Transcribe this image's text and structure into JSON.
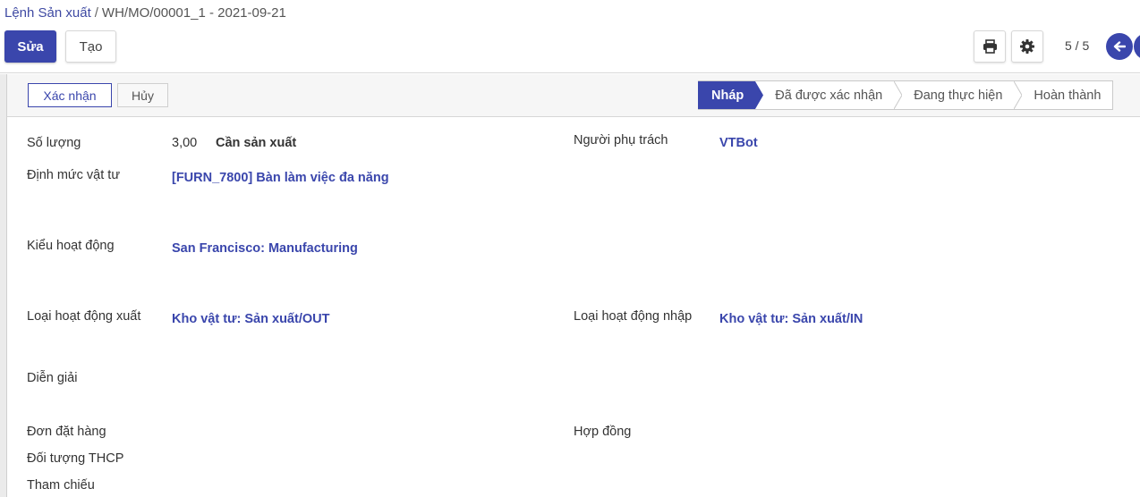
{
  "breadcrumb": {
    "parent": "Lệnh Sản xuất",
    "separator": "/",
    "current": "WH/MO/00001_1 - 2021-09-21"
  },
  "toolbar": {
    "edit_label": "Sửa",
    "create_label": "Tạo",
    "print_icon": "printer-icon",
    "settings_icon": "gear-icon"
  },
  "pager": {
    "value": "5 / 5",
    "prev_icon": "arrow-left-icon",
    "next_icon": "arrow-right-icon"
  },
  "statusbar": {
    "confirm_label": "Xác nhận",
    "cancel_label": "Hủy",
    "stages": [
      {
        "label": "Nháp",
        "active": true
      },
      {
        "label": "Đã được xác nhận",
        "active": false
      },
      {
        "label": "Đang thực hiện",
        "active": false
      },
      {
        "label": "Hoàn thành",
        "active": false
      }
    ]
  },
  "form": {
    "quantity": {
      "label": "Số lượng",
      "value": "3,00",
      "unit": "Cần sản xuất"
    },
    "responsible": {
      "label": "Người phụ trách",
      "value": "VTBot"
    },
    "bom": {
      "label": "Định mức vật tư",
      "value": "[FURN_7800] Bàn làm việc đa năng"
    },
    "operation_type": {
      "label": "Kiểu hoạt động",
      "value": "San Francisco: Manufacturing"
    },
    "out_operation": {
      "label": "Loại hoạt động xuất",
      "value": "Kho vật tư: Sản xuất/OUT"
    },
    "in_operation": {
      "label": "Loại hoạt động nhập",
      "value": "Kho vật tư: Sản xuất/IN"
    },
    "description": {
      "label": "Diễn giải"
    },
    "sale_order": {
      "label": "Đơn đặt hàng"
    },
    "contract": {
      "label": "Hợp đồng"
    },
    "cost_object": {
      "label": "Đối tượng THCP"
    },
    "reference": {
      "label": "Tham chiếu"
    }
  },
  "colors": {
    "primary": "#3a46ac",
    "link": "#3a46ac",
    "statusbar_bg": "#f6f6f6"
  }
}
